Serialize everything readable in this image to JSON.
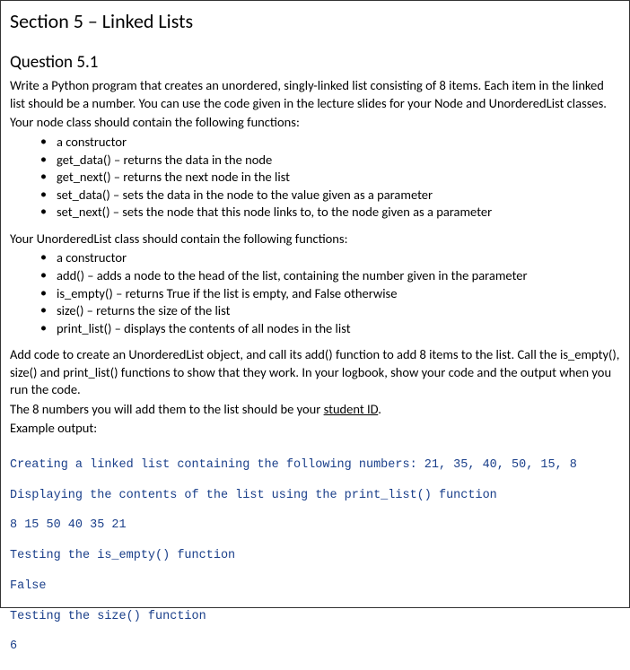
{
  "section_title": "Section 5 – Linked Lists",
  "question_title": "Question 5.1",
  "intro_paragraph": "Write a Python program that creates an unordered, singly-linked list consisting of 8 items. Each item in the linked list should be a number. You can use the code given in the lecture slides for your Node and UnorderedList classes.",
  "node_intro": "Your node class should contain the following functions:",
  "node_bullets": [
    "a constructor",
    "get_data() – returns the data in the node",
    "get_next() – returns the next node in the list",
    "set_data() – sets the data in the node to the value given as a parameter",
    "set_next() – sets the node that this node links to, to the node given as a parameter"
  ],
  "unordered_intro": "Your UnorderedList class should contain the following functions:",
  "unordered_bullets": [
    "a constructor",
    "add() – adds a node to the head of the list, containing the number given in the parameter",
    "is_empty() – returns True if the list is empty, and False otherwise",
    "size() – returns the size of the list",
    "print_list() – displays the contents of all nodes in the list"
  ],
  "add_code_para": "Add code to create an UnorderedList object, and call its add() function to add 8 items to the list. Call the is_empty(), size() and print_list() functions to show that they work. In your logbook, show your code and the output when you run the code.",
  "student_id_pre": "The 8 numbers you will add them to the list should be your ",
  "student_id_link": "student ID",
  "student_id_post": ".",
  "example_label": "Example output:",
  "output_lines": {
    "l1": "Creating a linked list containing the following numbers: 21, 35, 40, 50, 15, 8",
    "l2": "Displaying the contents of the list using the print_list() function",
    "l3": "8 15 50 40 35 21",
    "l4": "Testing the is_empty() function",
    "l5": "False",
    "l6": "Testing the size() function",
    "l7": "6"
  }
}
